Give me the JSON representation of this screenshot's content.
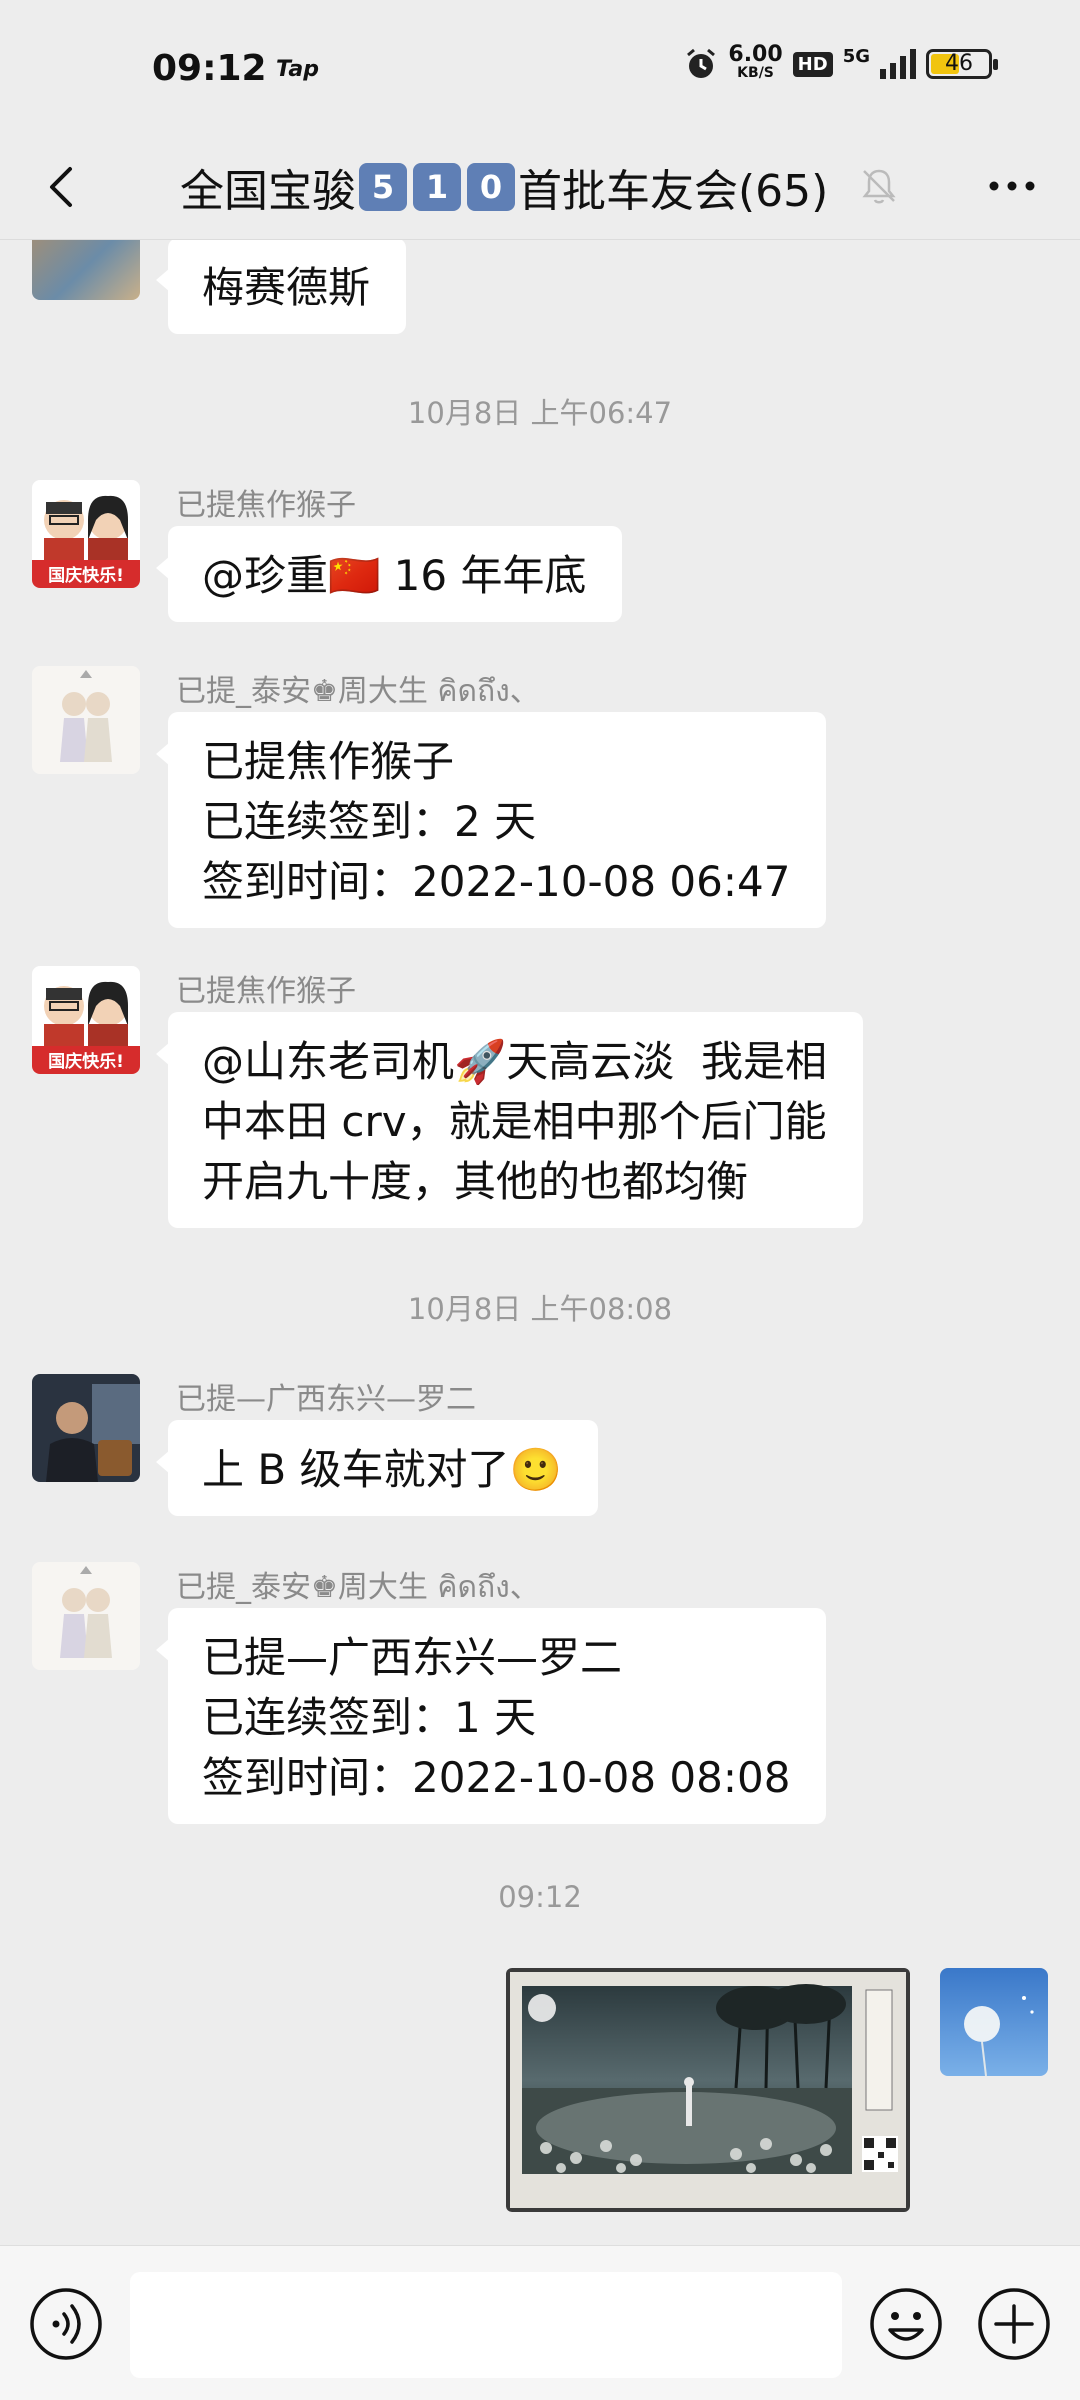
{
  "status_bar": {
    "time": "09:12",
    "app_badge": "Tap",
    "speed_value": "6.00",
    "speed_unit": "KB/S",
    "hd": "HD",
    "network": "5G",
    "battery": "46"
  },
  "header": {
    "title_prefix": "全国宝骏",
    "title_digits": [
      "5",
      "1",
      "0"
    ],
    "title_suffix": "首批车友会(65)"
  },
  "messages": {
    "m0_text": "梅赛德斯",
    "ts1": "10月8日 上午06:47",
    "m1_sender": "已提焦作猴子",
    "m1_text": "@珍重🇨🇳 16 年年底",
    "m2_sender": "已提_泰安♚周大生 คิดถึง、",
    "m2_text": "已提焦作猴子\n已连续签到：2 天\n签到时间：2022-10-08 06:47",
    "m3_sender": "已提焦作猴子",
    "m3_text": "@山东老司机🚀天高云淡  我是相\n中本田 crv，就是相中那个后门能\n开启九十度，其他的也都均衡",
    "ts2": "10月8日 上午08:08",
    "m4_sender": "已提—广西东兴—罗二",
    "m4_text": "上 B 级车就对了🙂",
    "m5_sender": "已提_泰安♚周大生 คิดถึง、",
    "m5_text": "已提—广西东兴—罗二\n已连续签到：1 天\n签到时间：2022-10-08 08:08",
    "ts3": "09:12"
  },
  "avatar_badge": "国庆快乐!",
  "colors": {
    "background": "#ededed",
    "bubble": "#ffffff",
    "timestamp": "#999999",
    "sender": "#8a8a8a",
    "digit_box": "#5f7fb5"
  },
  "icons": [
    "back-icon",
    "mute-icon",
    "more-icon",
    "voice-icon",
    "emoji-icon",
    "plus-icon"
  ]
}
